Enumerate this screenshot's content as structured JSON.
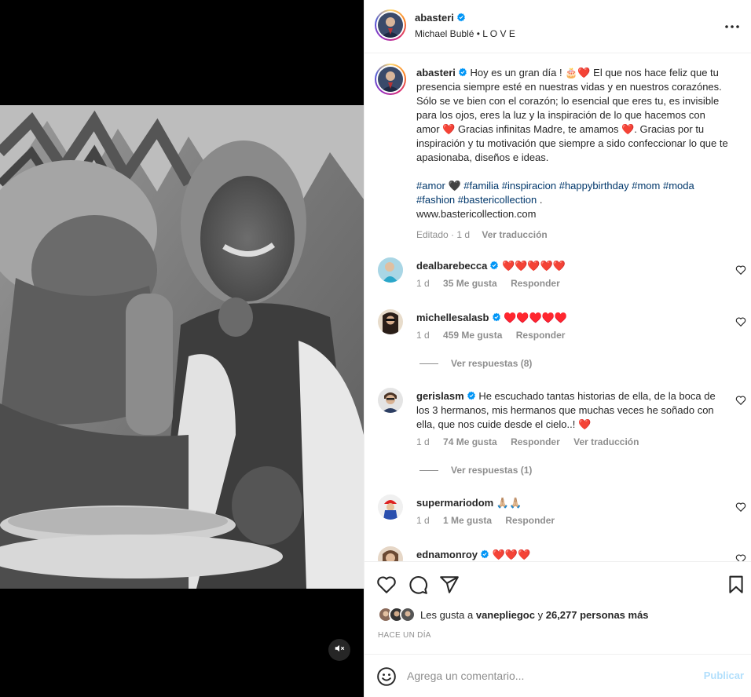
{
  "media": {
    "mute_icon": "speaker-muted-icon"
  },
  "header": {
    "username": "abasteri",
    "verified": true,
    "subtitle": "Michael Bublé • L O V E",
    "more_icon": "more-dots-icon"
  },
  "caption": {
    "username": "abasteri",
    "line1": "Hoy es un gran día ! 🎂❤️ El que nos hace feliz que tu presencia siempre esté en nuestras vidas y en nuestros corazónes. Sólo se ve bien con el corazón; lo esencial que eres tu, es invisible para los ojos, eres la luz y la inspiración de lo que hacemos con amor ❤️ Gracias infinitas Madre, te amamos ❤️. Gracias por tu inspiración y tu motivación que siempre a sido confeccionar lo que te apasionaba, diseños e ideas.",
    "hashtags": [
      "#amor",
      "🖤",
      "#familia",
      "#inspiracion",
      "#happybirthday",
      "#mom",
      "#moda",
      "#fashion",
      "#bastericollection",
      "."
    ],
    "link": "www.bastericollection.com",
    "edited": "Editado · 1 d",
    "translate": "Ver traducción"
  },
  "comments": [
    {
      "username": "dealbarebecca",
      "verified": true,
      "text": "❤️❤️❤️❤️❤️",
      "time": "1 d",
      "likes": "35 Me gusta",
      "reply": "Responder"
    },
    {
      "username": "michellesalasb",
      "verified": true,
      "text": "♥️♥️♥️♥️♥️",
      "time": "1 d",
      "likes": "459 Me gusta",
      "reply": "Responder",
      "view_replies": "Ver respuestas (8)"
    },
    {
      "username": "gerislasm",
      "verified": true,
      "text": "He escuchado tantas historias de ella, de la boca de los 3 hermanos, mis hermanos que muchas veces he soñado con ella, que nos cuide desde el cielo..! ❤️",
      "time": "1 d",
      "likes": "74 Me gusta",
      "reply": "Responder",
      "translate": "Ver traducción",
      "view_replies": "Ver respuestas (1)"
    },
    {
      "username": "supermariodom",
      "verified": false,
      "text": "🙏🏼🙏🏼",
      "time": "1 d",
      "likes": "1 Me gusta",
      "reply": "Responder"
    },
    {
      "username": "ednamonroy",
      "verified": true,
      "text": "❤️❤️❤️"
    }
  ],
  "actions": {
    "like_icon": "heart-icon",
    "comment_icon": "comment-icon",
    "share_icon": "share-icon",
    "save_icon": "bookmark-icon"
  },
  "likes": {
    "prefix": "Les gusta a",
    "user": "vanepliegoc",
    "middle": "y",
    "count": "26,277 personas más"
  },
  "timestamp": "HACE UN DÍA",
  "compose": {
    "placeholder": "Agrega un comentario...",
    "publish": "Publicar",
    "emoji_icon": "smiley-icon"
  },
  "colors": {
    "verified": "#0095f6",
    "link": "#00376b",
    "secondary": "#8e8e8e",
    "publish_disabled": "#b2dffc"
  }
}
